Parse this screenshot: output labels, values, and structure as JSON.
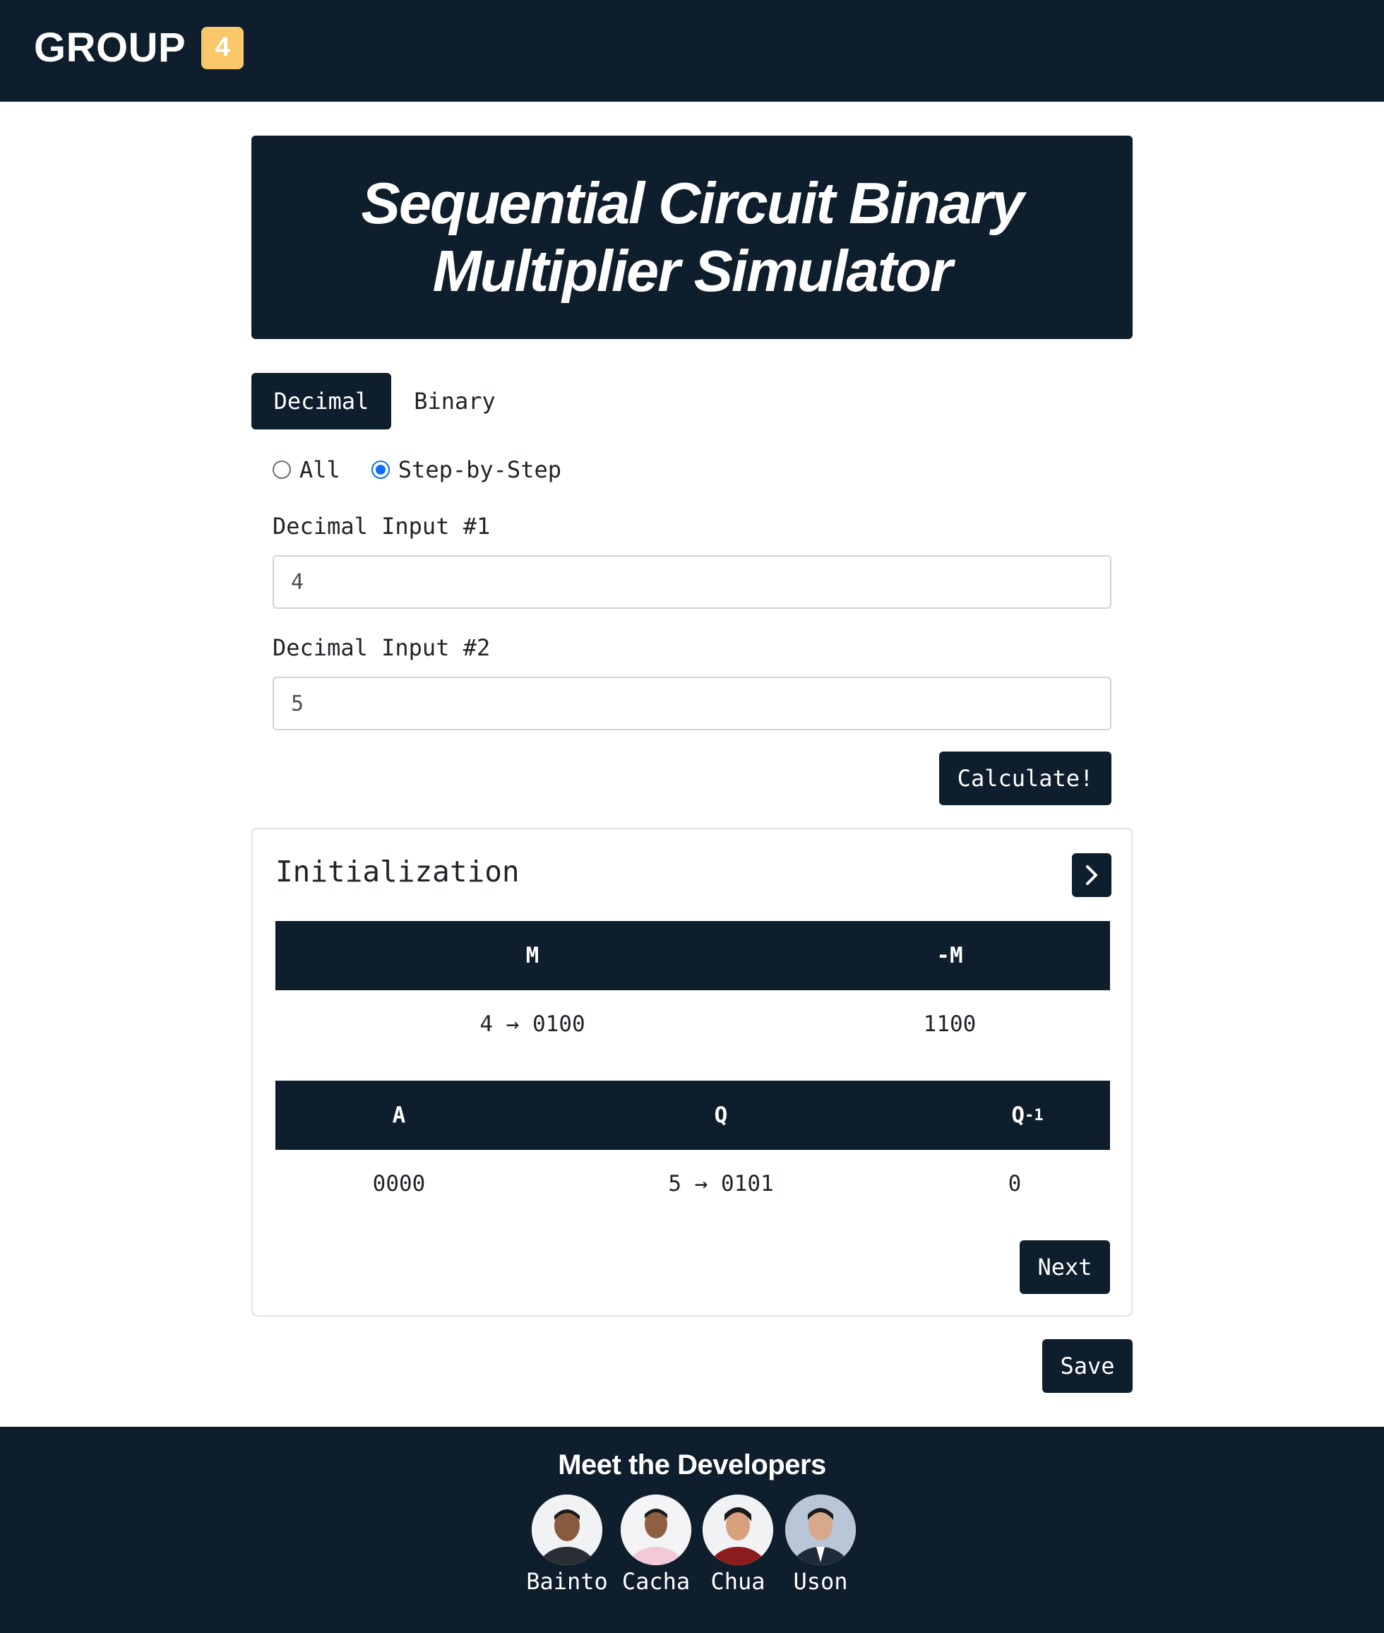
{
  "navbar": {
    "brand": "GROUP",
    "badge": "4"
  },
  "hero": {
    "title": "Sequential Circuit Binary Multiplier Simulator"
  },
  "tabs": [
    {
      "label": "Decimal",
      "active": true
    },
    {
      "label": "Binary",
      "active": false
    }
  ],
  "mode": {
    "options": [
      "All",
      "Step-by-Step"
    ],
    "selected": "Step-by-Step"
  },
  "form": {
    "input1_label": "Decimal Input #1",
    "input1_value": "4",
    "input2_label": "Decimal Input #2",
    "input2_value": "5",
    "calculate_label": "Calculate!"
  },
  "step_card": {
    "title": "Initialization",
    "table1": {
      "headers": [
        "M",
        "-M"
      ],
      "row": [
        "4 → 0100",
        "1100"
      ]
    },
    "table2": {
      "headers": [
        "A",
        "Q",
        "Q",
        "-1"
      ],
      "row": [
        "0000",
        "5 → 0101",
        "0"
      ]
    },
    "next_label": "Next"
  },
  "save_label": "Save",
  "footer": {
    "title": "Meet the Developers",
    "developers": [
      "Bainto",
      "Cacha",
      "Chua",
      "Uson"
    ]
  },
  "colors": {
    "dark": "#0f1e2c",
    "badge": "#f8c86a",
    "radio_accent": "#0d6efd"
  }
}
